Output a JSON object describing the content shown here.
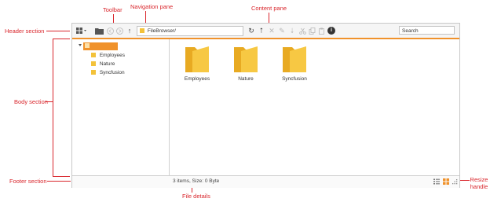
{
  "callouts": {
    "header": "Header section",
    "toolbar": "Toolbar",
    "navigation": "Navigation pane",
    "content": "Content pane",
    "body": "Body section",
    "footer": "Footer section",
    "file_details": "File details",
    "resize": "Resize handle"
  },
  "toolbar": {
    "address": "FileBrowser/",
    "search_placeholder": "Search",
    "up_glyph": "↑",
    "info_glyph": "i",
    "refresh_glyph": "↻",
    "upload_glyph": "⭡",
    "delete_glyph": "✕",
    "rename_glyph": "✎",
    "download_glyph": "⭣"
  },
  "navigation": {
    "root": "FileBrowser",
    "items": [
      {
        "label": "Employees"
      },
      {
        "label": "Nature"
      },
      {
        "label": "Syncfusion"
      }
    ]
  },
  "content": {
    "folders": [
      {
        "label": "Employees"
      },
      {
        "label": "Nature"
      },
      {
        "label": "Syncfusion"
      }
    ]
  },
  "footer": {
    "details": "3 items, Size: 0 Byte"
  },
  "colors": {
    "accent": "#f0922b",
    "folder": "#f3c23a",
    "callout": "#d9262c"
  }
}
